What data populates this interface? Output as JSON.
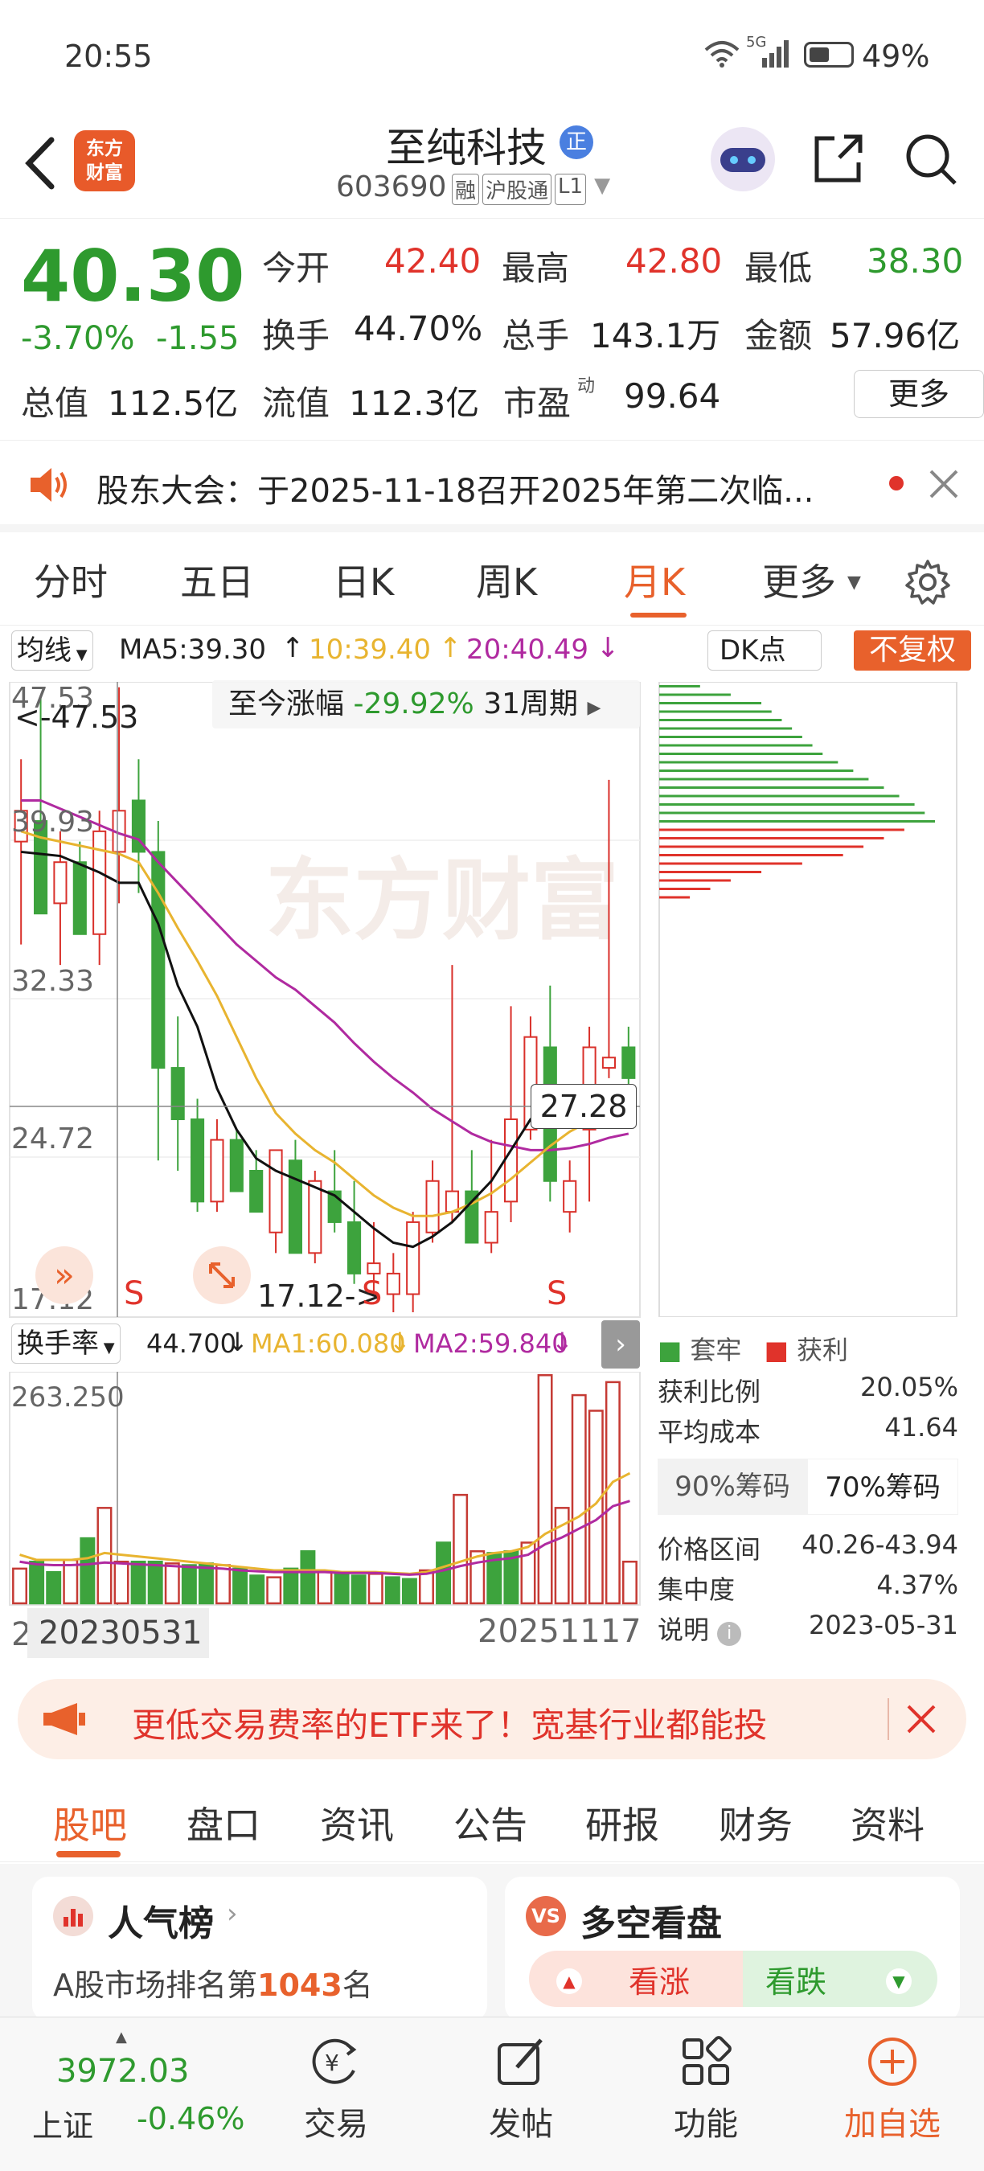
{
  "status": {
    "time": "20:55",
    "battery": "49%",
    "network": "5G"
  },
  "header": {
    "title": "至纯科技",
    "badge": "正",
    "code": "603690",
    "tags": [
      "融",
      "沪股通",
      "L1"
    ],
    "logo_text_line1": "东方",
    "logo_text_line2": "财富"
  },
  "quote": {
    "price": "40.30",
    "change_pct": "-3.70%",
    "change_abs": "-1.55",
    "rows": [
      [
        {
          "label": "今开",
          "value": "42.40",
          "color": "#e0332b"
        },
        {
          "label": "最高",
          "value": "42.80",
          "color": "#e0332b"
        },
        {
          "label": "最低",
          "value": "38.30",
          "color": "#2e9a2e"
        }
      ],
      [
        {
          "label": "换手",
          "value": "44.70%",
          "color": "#222"
        },
        {
          "label": "总手",
          "value": "143.1万",
          "color": "#222"
        },
        {
          "label": "金额",
          "value": "57.96亿",
          "color": "#222"
        }
      ]
    ],
    "total_value_label": "总值",
    "total_value": "112.5亿",
    "float_value_label": "流值",
    "float_value": "112.3亿",
    "pe_label": "市盈",
    "pe_sup": "动",
    "pe_value": "99.64",
    "more_button": "更多"
  },
  "notice": {
    "text": "股东大会：于2025-11-18召开2025年第二次临..."
  },
  "period_tabs": [
    "分时",
    "五日",
    "日K",
    "周K",
    "月K",
    "更多"
  ],
  "active_tab": "月K",
  "chart_header": {
    "ma_select": "均线",
    "ma5": "MA5:39.30",
    "ma10": "10:39.40",
    "ma20": "20:40.49",
    "dk_button": "DK点",
    "fuquan_button": "不复权",
    "range_label": "至今涨幅",
    "range_value": "-29.92%",
    "range_period": "31周期"
  },
  "price_axis": [
    "47.53",
    "39.93",
    "32.33",
    "24.72",
    "17.12"
  ],
  "max_label": "<-47.53",
  "min_label": "17.12->",
  "crosshair_value": "27.28",
  "s_marks": [
    "S",
    "S",
    "S"
  ],
  "volume_header": {
    "select": "换手率",
    "value": "44.700",
    "ma1": "MA1:60.080",
    "ma2": "MA2:59.840",
    "axis_top": "263.250"
  },
  "date_start": "20230531",
  "date_end": "20251117",
  "date_left_stub": "2",
  "chip": {
    "legend_trapped": "套牢",
    "legend_profit": "获利",
    "rows": [
      {
        "label": "获利比例",
        "value": "20.05%"
      },
      {
        "label": "平均成本",
        "value": "41.64"
      }
    ],
    "tab90": "90%筹码",
    "tab70": "70%筹码",
    "rows2": [
      {
        "label": "价格区间",
        "value": "40.26-43.94"
      },
      {
        "label": "集中度",
        "value": "4.37%"
      },
      {
        "label": "说明",
        "value": "2023-05-31"
      }
    ]
  },
  "banner": {
    "text": "更低交易费率的ETF来了！宽基行业都能投"
  },
  "sub_tabs": [
    "股吧",
    "盘口",
    "资讯",
    "公告",
    "研报",
    "财务",
    "资料"
  ],
  "cards": {
    "popularity_title": "人气榜",
    "popularity_text_pre": "A股市场排名第",
    "popularity_rank": "1043",
    "popularity_text_post": "名",
    "vs_title": "多空看盘",
    "bull": "看涨",
    "bear": "看跌"
  },
  "bottom": {
    "index_value": "3972.03",
    "index_name": "上证",
    "index_change": "-0.46%",
    "items": [
      "交易",
      "发帖",
      "功能",
      "加自选"
    ]
  },
  "chart_data": {
    "type": "candlestick",
    "period": "monthly",
    "x_start": "20230531",
    "x_end": "20251117",
    "ylim": [
      17.12,
      47.53
    ],
    "candles": [
      [
        40.0,
        44.0,
        35.0,
        41.5
      ],
      [
        41.0,
        47.0,
        40.0,
        36.5
      ],
      [
        37.0,
        40.5,
        34.0,
        39.0
      ],
      [
        39.0,
        40.0,
        35.5,
        35.5
      ],
      [
        35.5,
        41.5,
        34.0,
        40.5
      ],
      [
        39.5,
        47.5,
        37.0,
        41.5
      ],
      [
        42.0,
        44.0,
        37.5,
        39.5
      ],
      [
        39.5,
        41.0,
        24.5,
        29.0
      ],
      [
        29.0,
        31.5,
        24.0,
        26.5
      ],
      [
        26.5,
        27.5,
        22.0,
        22.5
      ],
      [
        22.5,
        26.5,
        22.0,
        25.5
      ],
      [
        25.5,
        26.0,
        23.0,
        23.0
      ],
      [
        24.0,
        25.0,
        22.0,
        22.0
      ],
      [
        21.0,
        25.0,
        20.0,
        25.0
      ],
      [
        24.5,
        25.5,
        21.0,
        20.0
      ],
      [
        20.0,
        24.0,
        19.5,
        23.5
      ],
      [
        23.0,
        25.0,
        21.0,
        21.5
      ],
      [
        21.5,
        23.5,
        18.5,
        19.0
      ],
      [
        19.0,
        21.5,
        18.0,
        19.5
      ],
      [
        18.0,
        20.0,
        17.12,
        19.0
      ],
      [
        18.0,
        22.0,
        17.12,
        21.5
      ],
      [
        21.0,
        24.5,
        20.5,
        23.5
      ],
      [
        22.0,
        34.0,
        21.5,
        23.0
      ],
      [
        23.0,
        25.0,
        21.0,
        20.5
      ],
      [
        20.5,
        25.5,
        20.0,
        22.0
      ],
      [
        22.5,
        32.0,
        21.5,
        26.5
      ],
      [
        26.0,
        31.5,
        25.5,
        30.5
      ],
      [
        30.0,
        33.0,
        22.5,
        23.5
      ],
      [
        22.0,
        24.5,
        21.0,
        23.5
      ],
      [
        26.0,
        31.0,
        22.5,
        30.0
      ],
      [
        29.0,
        43.0,
        28.5,
        29.5
      ],
      [
        30.0,
        31.0,
        28.0,
        28.5
      ]
    ],
    "ma5": [
      39.5,
      39.4,
      39.3,
      38.9,
      38.5,
      38.0,
      38.0,
      36.0,
      33.0,
      31.0,
      28.0,
      26.0,
      24.6,
      24.0,
      23.6,
      23.2,
      22.8,
      22.0,
      21.2,
      20.5,
      20.3,
      20.8,
      21.5,
      22.5,
      23.5,
      25.0,
      26.5,
      27.0,
      27.2,
      27.4,
      27.5,
      27.3
    ],
    "ma10": [
      40.5,
      40.2,
      40.0,
      39.8,
      39.6,
      39.4,
      39.0,
      37.5,
      35.8,
      34.2,
      32.5,
      30.5,
      28.5,
      26.8,
      25.8,
      25.0,
      24.4,
      23.6,
      22.8,
      22.2,
      21.8,
      21.8,
      22.0,
      22.4,
      22.9,
      23.6,
      24.4,
      25.2,
      25.9,
      26.4,
      26.9,
      27.2
    ],
    "ma20": [
      42.0,
      42.0,
      41.6,
      41.2,
      40.8,
      40.4,
      40.1,
      39.0,
      38.0,
      37.0,
      36.0,
      35.0,
      34.2,
      33.4,
      32.8,
      32.0,
      31.2,
      30.2,
      29.3,
      28.5,
      27.8,
      27.0,
      26.4,
      25.8,
      25.4,
      25.2,
      25.0,
      25.0,
      25.1,
      25.3,
      25.6,
      25.8
    ],
    "turnover_ylim": [
      0,
      263.25
    ],
    "turnover": [
      40,
      48,
      36,
      50,
      75,
      110,
      48,
      48,
      48,
      46,
      44,
      46,
      44,
      40,
      32,
      30,
      40,
      60,
      36,
      34,
      32,
      34,
      30,
      28,
      38,
      70,
      125,
      60,
      58,
      60,
      70,
      263,
      110,
      240,
      222,
      255,
      48
    ],
    "turnover_ma1": [
      56,
      50,
      50,
      50,
      52,
      58,
      56,
      54,
      52,
      50,
      48,
      46,
      44,
      42,
      40,
      38,
      38,
      38,
      38,
      36,
      36,
      36,
      35,
      34,
      36,
      42,
      48,
      54,
      58,
      60,
      65,
      80,
      90,
      100,
      115,
      140,
      150
    ],
    "turnover_ma2": [
      48,
      45,
      44,
      44,
      45,
      47,
      46,
      45,
      44,
      43,
      42,
      41,
      40,
      38,
      37,
      36,
      36,
      36,
      36,
      35,
      35,
      35,
      34,
      33,
      34,
      38,
      43,
      47,
      50,
      52,
      56,
      68,
      76,
      86,
      96,
      112,
      118
    ],
    "chips_trapped": [
      8,
      14,
      20,
      22,
      24,
      26,
      28,
      30,
      32,
      35,
      38,
      41,
      44,
      47,
      50,
      52,
      54
    ],
    "chips_profit": [
      48,
      44,
      40,
      36,
      28,
      20,
      14,
      10,
      6
    ]
  }
}
